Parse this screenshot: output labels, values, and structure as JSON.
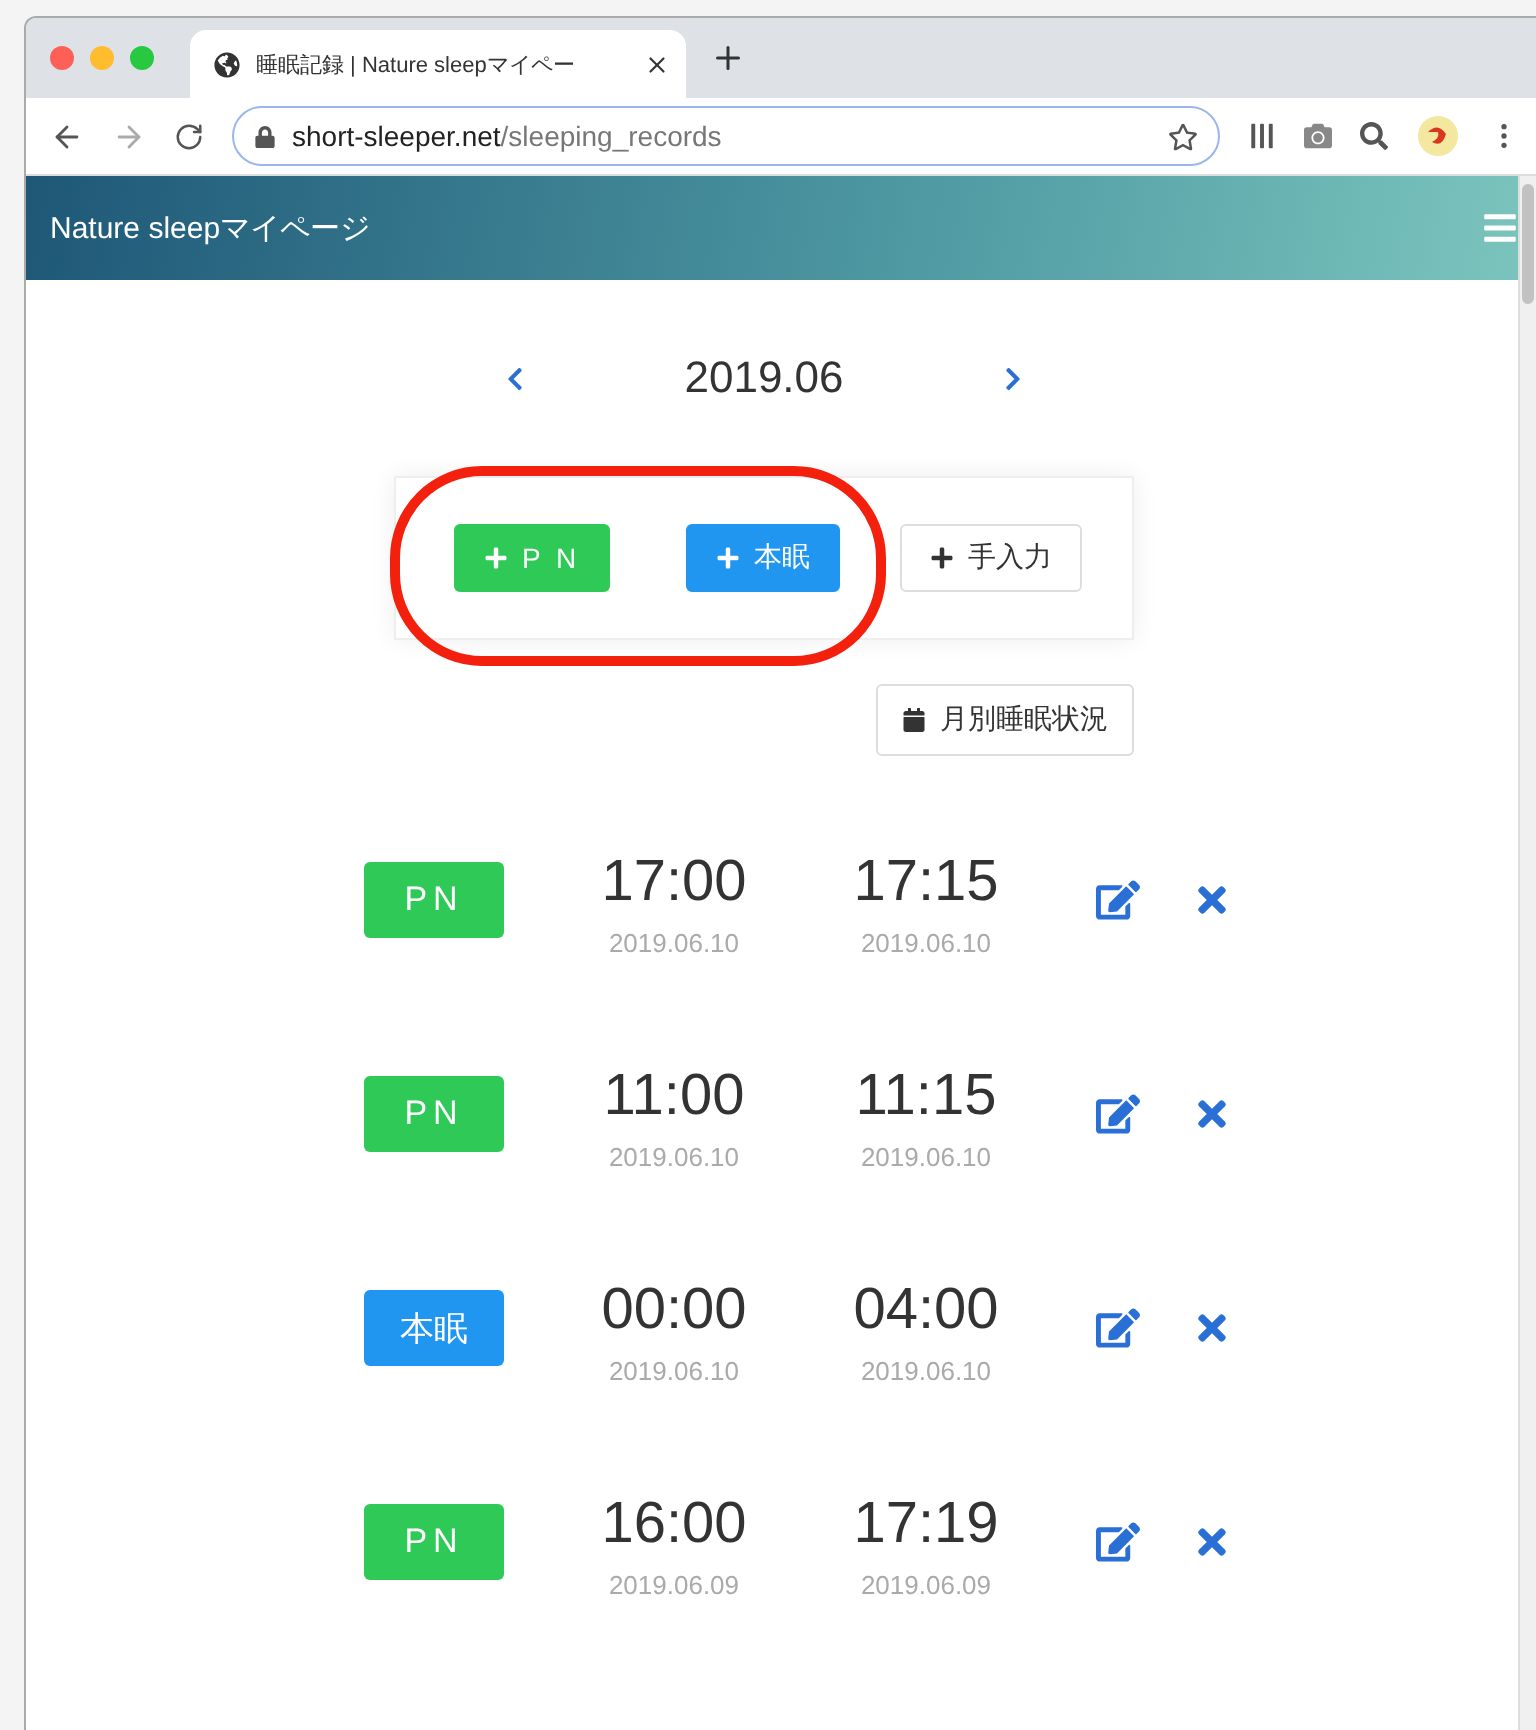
{
  "browser": {
    "tab_title": "睡眠記録 | Nature sleepマイペー",
    "url_host": "short-sleeper.net",
    "url_path": "/sleeping_records"
  },
  "header": {
    "title": "Nature sleepマイページ"
  },
  "month_nav": {
    "label": "2019.06"
  },
  "add_buttons": [
    {
      "kind": "pn",
      "label": "P N"
    },
    {
      "kind": "main",
      "label": "本眠"
    },
    {
      "kind": "manual",
      "label": "手入力"
    }
  ],
  "monthly_button": {
    "label": "月別睡眠状況"
  },
  "records": [
    {
      "kind": "pn",
      "label": "PN",
      "start_time": "17:00",
      "start_date": "2019.06.10",
      "end_time": "17:15",
      "end_date": "2019.06.10"
    },
    {
      "kind": "pn",
      "label": "PN",
      "start_time": "11:00",
      "start_date": "2019.06.10",
      "end_time": "11:15",
      "end_date": "2019.06.10"
    },
    {
      "kind": "main",
      "label": "本眠",
      "start_time": "00:00",
      "start_date": "2019.06.10",
      "end_time": "04:00",
      "end_date": "2019.06.10"
    },
    {
      "kind": "pn",
      "label": "PN",
      "start_time": "16:00",
      "start_date": "2019.06.09",
      "end_time": "17:19",
      "end_date": "2019.06.09"
    }
  ]
}
